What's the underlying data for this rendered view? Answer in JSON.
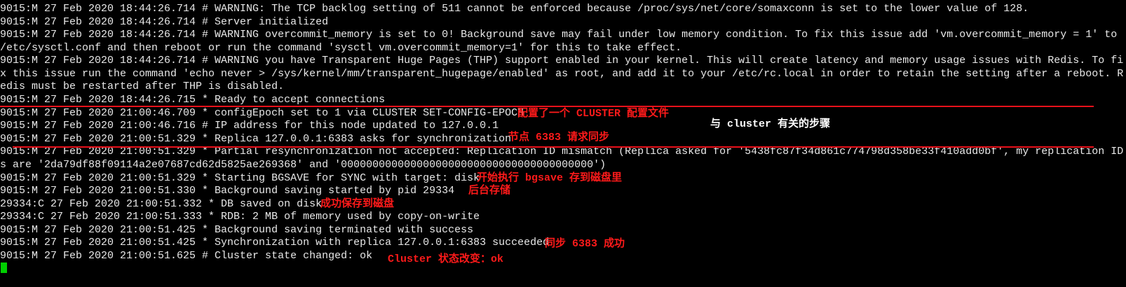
{
  "terminal": {
    "lines": [
      "9015:M 27 Feb 2020 18:44:26.714 # WARNING: The TCP backlog setting of 511 cannot be enforced because /proc/sys/net/core/somaxconn is set to the lower value of 128.",
      "9015:M 27 Feb 2020 18:44:26.714 # Server initialized",
      "9015:M 27 Feb 2020 18:44:26.714 # WARNING overcommit_memory is set to 0! Background save may fail under low memory condition. To fix this issue add 'vm.overcommit_memory = 1' to",
      "/etc/sysctl.conf and then reboot or run the command 'sysctl vm.overcommit_memory=1' for this to take effect.",
      "9015:M 27 Feb 2020 18:44:26.714 # WARNING you have Transparent Huge Pages (THP) support enabled in your kernel. This will create latency and memory usage issues with Redis. To fi",
      "x this issue run the command 'echo never > /sys/kernel/mm/transparent_hugepage/enabled' as root, and add it to your /etc/rc.local in order to retain the setting after a reboot. R",
      "edis must be restarted after THP is disabled.",
      "9015:M 27 Feb 2020 18:44:26.715 * Ready to accept connections",
      "9015:M 27 Feb 2020 21:00:46.709 * configEpoch set to 1 via CLUSTER SET-CONFIG-EPOCH",
      "9015:M 27 Feb 2020 21:00:46.716 # IP address for this node updated to 127.0.0.1",
      "9015:M 27 Feb 2020 21:00:51.329 * Replica 127.0.0.1:6383 asks for synchronization",
      "9015:M 27 Feb 2020 21:00:51.329 * Partial resynchronization not accepted: Replication ID mismatch (Replica asked for '5438fc87f34d861c774798d358be33f410add0bf', my replication ID",
      "s are '2da79df88f09114a2e07687cd62d5825ae269368' and '0000000000000000000000000000000000000000')",
      "9015:M 27 Feb 2020 21:00:51.329 * Starting BGSAVE for SYNC with target: disk",
      "9015:M 27 Feb 2020 21:00:51.330 * Background saving started by pid 29334",
      "29334:C 27 Feb 2020 21:00:51.332 * DB saved on disk",
      "29334:C 27 Feb 2020 21:00:51.333 * RDB: 2 MB of memory used by copy-on-write",
      "9015:M 27 Feb 2020 21:00:51.425 * Background saving terminated with success",
      "9015:M 27 Feb 2020 21:00:51.425 * Synchronization with replica 127.0.0.1:6383 succeeded",
      "9015:M 27 Feb 2020 21:00:51.625 # Cluster state changed: ok"
    ]
  },
  "annotations": {
    "config_cluster": "配置了一个 CLUSTER 配置文件",
    "cluster_steps": "与 cluster 有关的步骤",
    "node_sync_request": "节点 6383 请求同步",
    "start_bgsave": "开始执行 bgsave 存到磁盘里",
    "background_save": "后台存储",
    "saved_to_disk": "成功保存到磁盘",
    "sync_success": "同步 6383 成功",
    "cluster_state": "Cluster 状态改变：ok"
  },
  "colors": {
    "background": "#000000",
    "text": "#e8e8e8",
    "annotation": "#ff1a1a",
    "cursor": "#00d000"
  }
}
